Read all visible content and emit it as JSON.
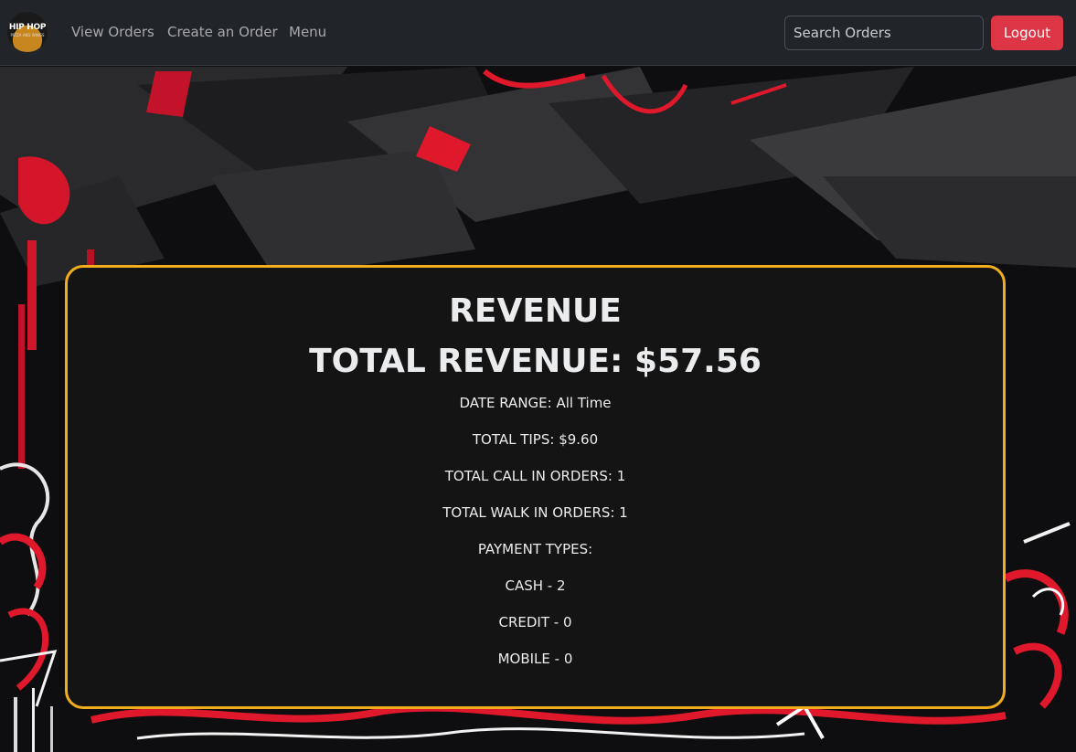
{
  "nav": {
    "logo_text": "HIP HOP",
    "logo_sub": "PIZZA AND WINGS",
    "view_orders": "View Orders",
    "create_order": "Create an Order",
    "menu": "Menu",
    "search_placeholder": "Search Orders",
    "logout": "Logout"
  },
  "revenue": {
    "heading": "REVENUE",
    "total_revenue": "TOTAL REVENUE: $57.56",
    "date_range": "DATE RANGE: All Time",
    "total_tips": "TOTAL TIPS: $9.60",
    "call_in_orders": "TOTAL CALL IN ORDERS: 1",
    "walk_in_orders": "TOTAL WALK IN ORDERS: 1",
    "payment_types_label": "PAYMENT TYPES:",
    "payment_types": [
      "CASH - 2",
      "CREDIT - 0",
      "MOBILE - 0"
    ]
  },
  "colors": {
    "navbar_bg": "#212429",
    "logout_button": "#dc3545",
    "card_border": "#f0ad1c",
    "card_bg": "#141415",
    "graffiti_red": "#e0182c"
  }
}
